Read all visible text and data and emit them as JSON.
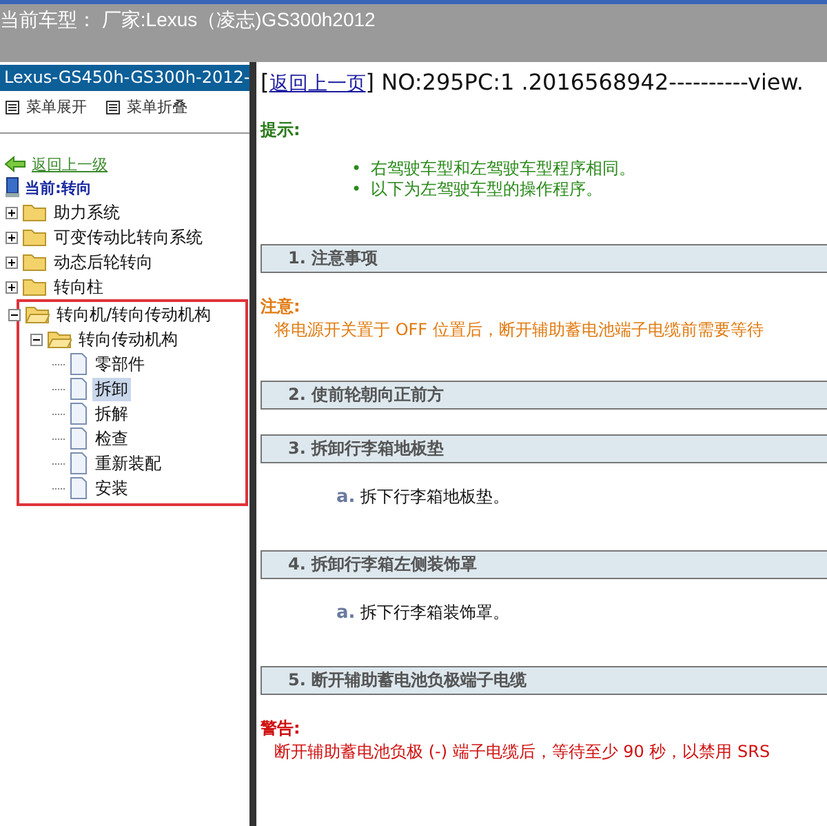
{
  "header": {
    "title": "当前车型：  厂家:Lexus（凌志)GS300h2012"
  },
  "sidebar": {
    "title": "Lexus-GS450h-GS300h-2012-",
    "toolbar": [
      "菜单展开",
      "菜单折叠"
    ],
    "back_link": "返回上一级",
    "current": "当前:转向",
    "tree": [
      {
        "label": "助力系统",
        "kind": "folder",
        "expanded": false,
        "selected": false,
        "highlighted": false
      },
      {
        "label": "可变传动比转向系统",
        "kind": "folder",
        "expanded": false,
        "selected": false,
        "highlighted": false
      },
      {
        "label": "动态后轮转向",
        "kind": "folder",
        "expanded": false,
        "selected": false,
        "highlighted": false
      },
      {
        "label": "转向柱",
        "kind": "folder",
        "expanded": false,
        "selected": false,
        "highlighted": false
      },
      {
        "label": "转向机/转向传动机构",
        "kind": "folder",
        "expanded": true,
        "selected": false,
        "highlighted": true,
        "children": [
          {
            "label": "转向传动机构",
            "kind": "folder",
            "expanded": true,
            "selected": false,
            "children": [
              {
                "label": "零部件",
                "kind": "page",
                "selected": false
              },
              {
                "label": "拆卸",
                "kind": "page",
                "selected": true
              },
              {
                "label": "拆解",
                "kind": "page",
                "selected": false
              },
              {
                "label": "检查",
                "kind": "page",
                "selected": false
              },
              {
                "label": "重新装配",
                "kind": "page",
                "selected": false
              },
              {
                "label": "安装",
                "kind": "page",
                "selected": false
              }
            ]
          }
        ]
      }
    ]
  },
  "content": {
    "bracket_open": "[",
    "back_link": "返回上一页",
    "bracket_close": "]",
    "doc_id": "NO:295PC:1 .2016568942----------view.",
    "tip": {
      "title": "提示:",
      "items": [
        {
          "bullet": "•",
          "text": "右驾驶车型和左驾驶车型程序相同。"
        },
        {
          "bullet": "•",
          "text": "以下为左驾驶车型的操作程序。"
        }
      ]
    },
    "blocks": [
      {
        "kind": "heading",
        "text": "1. 注意事项"
      },
      {
        "kind": "note",
        "title": "注意:",
        "text": "将电源开关置于 OFF 位置后，断开辅助蓄电池端子电缆前需要等待"
      },
      {
        "kind": "heading",
        "text": "2. 使前轮朝向正前方"
      },
      {
        "kind": "heading",
        "text": "3. 拆卸行李箱地板垫"
      },
      {
        "kind": "step",
        "mark": "a.",
        "text": "拆下行李箱地板垫。"
      },
      {
        "kind": "heading",
        "text": "4. 拆卸行李箱左侧装饰罩"
      },
      {
        "kind": "step",
        "mark": "a.",
        "text": "拆下行李箱装饰罩。"
      },
      {
        "kind": "heading",
        "text": "5. 断开辅助蓄电池负极端子电缆"
      },
      {
        "kind": "warning",
        "title": "警告:",
        "text": "断开辅助蓄电池负极 (-) 端子电缆后，等待至少 90 秒，以禁用 SRS"
      }
    ]
  }
}
